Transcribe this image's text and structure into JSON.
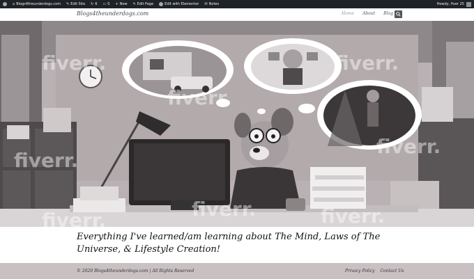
{
  "admin_bar": {
    "items": [
      {
        "icon": "wordpress-icon",
        "label": ""
      },
      {
        "icon": "home-icon",
        "label": "Blogs4theunderdogs.com"
      },
      {
        "icon": "pencil-icon",
        "label": "Edit Site"
      },
      {
        "icon": "updates-icon",
        "label": "6"
      },
      {
        "icon": "comments-icon",
        "label": "0"
      },
      {
        "icon": "plus-icon",
        "label": "New"
      },
      {
        "icon": "pencil-icon",
        "label": "Edit Page"
      },
      {
        "icon": "elementor-icon",
        "label": "Edit with Elementor"
      },
      {
        "icon": "notes-icon",
        "label": "Notes"
      }
    ],
    "greeting": "Howdy, fiver 25"
  },
  "header": {
    "logo": "Blogs4theunderdogs.com",
    "nav": [
      "Home",
      "About",
      "Blog"
    ]
  },
  "hero": {
    "watermark": "fiverr."
  },
  "tagline": "Everything I've learned/am learning about The Mind, Laws of The Universe, & Lifestyle Creation!",
  "footer": {
    "copyright": "© 2020 Blogs4theunderdogs.com | All Rights Reserved",
    "links": [
      "Privacy Policy",
      "Contact Us"
    ]
  }
}
